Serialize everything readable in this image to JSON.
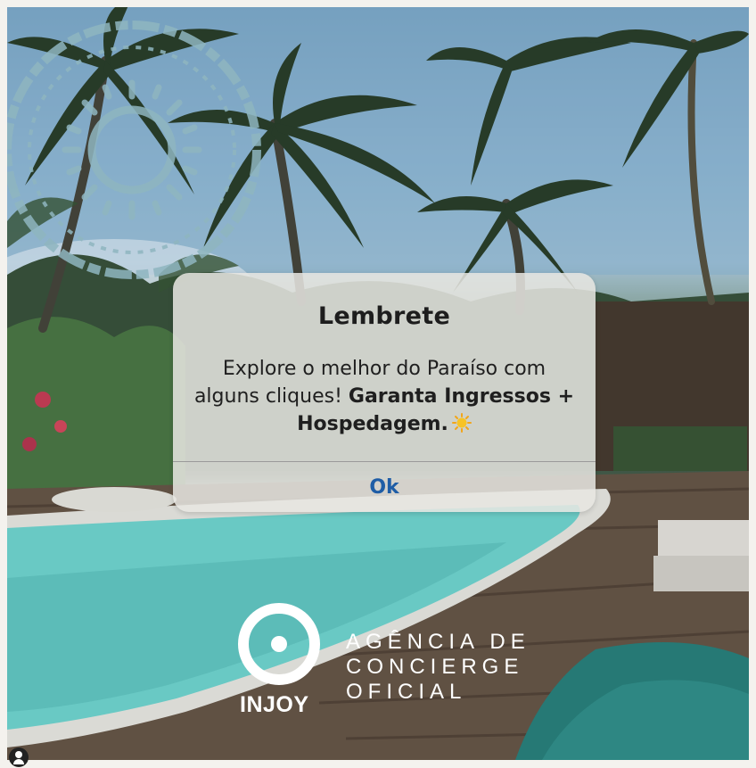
{
  "dialog": {
    "title": "Lembrete",
    "message_plain": "Explore o melhor do Paraíso com alguns cliques!",
    "message_bold": "Garanta Ingressos + Hospedagem.",
    "sun_emoji": "sun-icon",
    "ok_label": "Ok"
  },
  "brand": {
    "name": "INJOY",
    "tagline": [
      "AGÊNCIA DE",
      "CONCIERGE",
      "OFICIAL"
    ]
  },
  "colors": {
    "ok_text": "#1f5da6",
    "stamp": "#8fb6c0",
    "pool": "#5fc1bd"
  }
}
